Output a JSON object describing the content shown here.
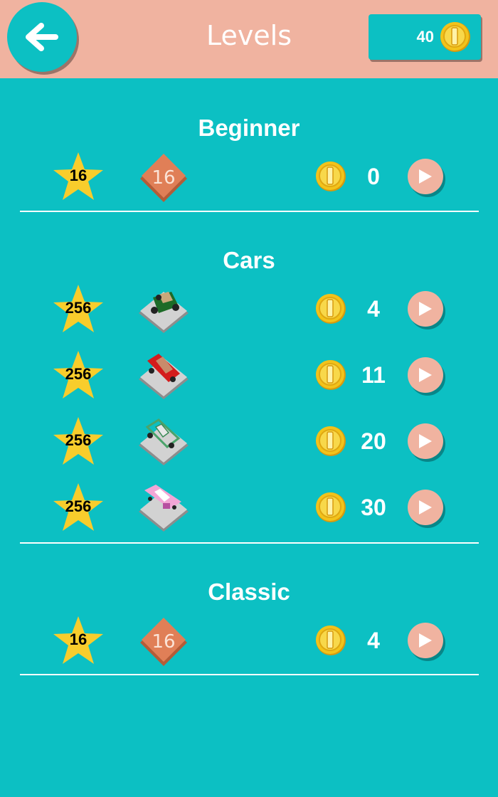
{
  "header": {
    "title": "Levels",
    "back_icon": "back-arrow-icon",
    "coins": "40"
  },
  "colors": {
    "background": "#0cc0c3",
    "header": "#f0b3a0",
    "star": "#f8cd2c",
    "coin": "#f2c31b",
    "play_button": "#f0b3a0"
  },
  "sections": [
    {
      "title": "Beginner",
      "levels": [
        {
          "stars": "16",
          "thumbnail": "number-16-tile",
          "price": "0"
        }
      ]
    },
    {
      "title": "Cars",
      "levels": [
        {
          "stars": "256",
          "thumbnail": "green-vintage-car",
          "price": "4"
        },
        {
          "stars": "256",
          "thumbnail": "red-convertible-car",
          "price": "11"
        },
        {
          "stars": "256",
          "thumbnail": "green-frame-car",
          "price": "20"
        },
        {
          "stars": "256",
          "thumbnail": "pink-classic-car",
          "price": "30"
        }
      ]
    },
    {
      "title": "Classic",
      "levels": [
        {
          "stars": "16",
          "thumbnail": "number-16-tile",
          "price": "4"
        }
      ]
    }
  ]
}
